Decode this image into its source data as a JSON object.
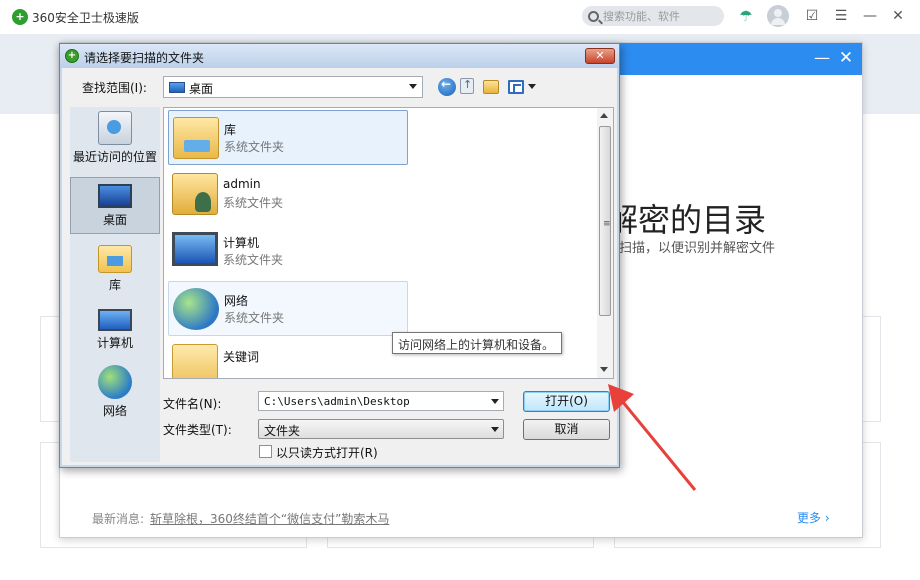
{
  "app": {
    "title": "360安全卫士极速版",
    "search_placeholder": "搜索功能、软件"
  },
  "inner": {
    "heading": "解密的目录",
    "subtitle": "行扫描，以便识别并解密文件",
    "news_label": "最新消息:",
    "news_link": "斩草除根，360终结首个“微信支付”勒索木马",
    "more_label": "更多 ›"
  },
  "dialog": {
    "title": "请选择要扫描的文件夹",
    "look_in_label": "查找范围(I):",
    "look_in_value": "桌面",
    "places": [
      {
        "label": "最近访问的位置",
        "icon": "recent-places-icon"
      },
      {
        "label": "桌面",
        "icon": "desktop-icon"
      },
      {
        "label": "库",
        "icon": "library-icon"
      },
      {
        "label": "计算机",
        "icon": "computer-icon"
      },
      {
        "label": "网络",
        "icon": "network-icon"
      }
    ],
    "items": [
      {
        "name": "库",
        "type": "系统文件夹"
      },
      {
        "name": "admin",
        "type": "系统文件夹"
      },
      {
        "name": "计算机",
        "type": "系统文件夹"
      },
      {
        "name": "网络",
        "type": "系统文件夹"
      },
      {
        "name": "关键词",
        "type": ""
      }
    ],
    "tooltip": "访问网络上的计算机和设备。",
    "filename_label": "文件名(N):",
    "filename_value": "C:\\Users\\admin\\Desktop",
    "filetype_label": "文件类型(T):",
    "filetype_value": "文件夹",
    "readonly_label": "以只读方式打开(R)",
    "open_button": "打开(O)",
    "cancel_button": "取消"
  },
  "colors": {
    "accent_blue": "#2d8cf0",
    "annotation_red": "#e8403a"
  }
}
